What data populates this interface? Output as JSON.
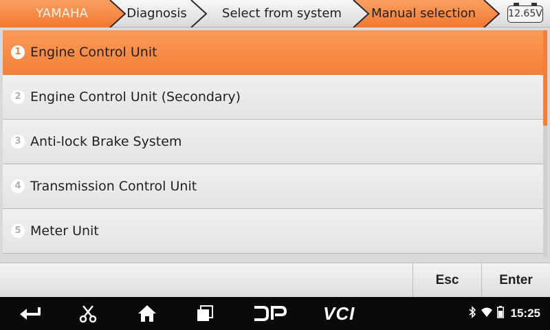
{
  "breadcrumb": [
    {
      "label": "YAMAHA"
    },
    {
      "label": "Diagnosis"
    },
    {
      "label": "Select from system"
    },
    {
      "label": "Manual selection"
    }
  ],
  "battery": {
    "voltage": "12.65V"
  },
  "systems": [
    {
      "num": "1",
      "label": "Engine Control Unit",
      "selected": true
    },
    {
      "num": "2",
      "label": "Engine Control Unit (Secondary)",
      "selected": false
    },
    {
      "num": "3",
      "label": "Anti-lock Brake System",
      "selected": false
    },
    {
      "num": "4",
      "label": "Transmission Control Unit",
      "selected": false
    },
    {
      "num": "5",
      "label": "Meter Unit",
      "selected": false
    }
  ],
  "scroll": {
    "visible_fraction": 0.42
  },
  "actions": {
    "esc_label": "Esc",
    "enter_label": "Enter"
  },
  "navbar": {
    "icons": [
      "back-icon",
      "scissors-icon",
      "home-icon",
      "recent-apps-icon",
      "dp-logo-icon"
    ],
    "vci_label": "VCI",
    "status_icons": [
      "bluetooth-icon",
      "wifi-icon",
      "battery-icon"
    ],
    "time": "15:25"
  },
  "colors": {
    "accent": "#f48038",
    "crumb_active": "#fa9a58"
  }
}
